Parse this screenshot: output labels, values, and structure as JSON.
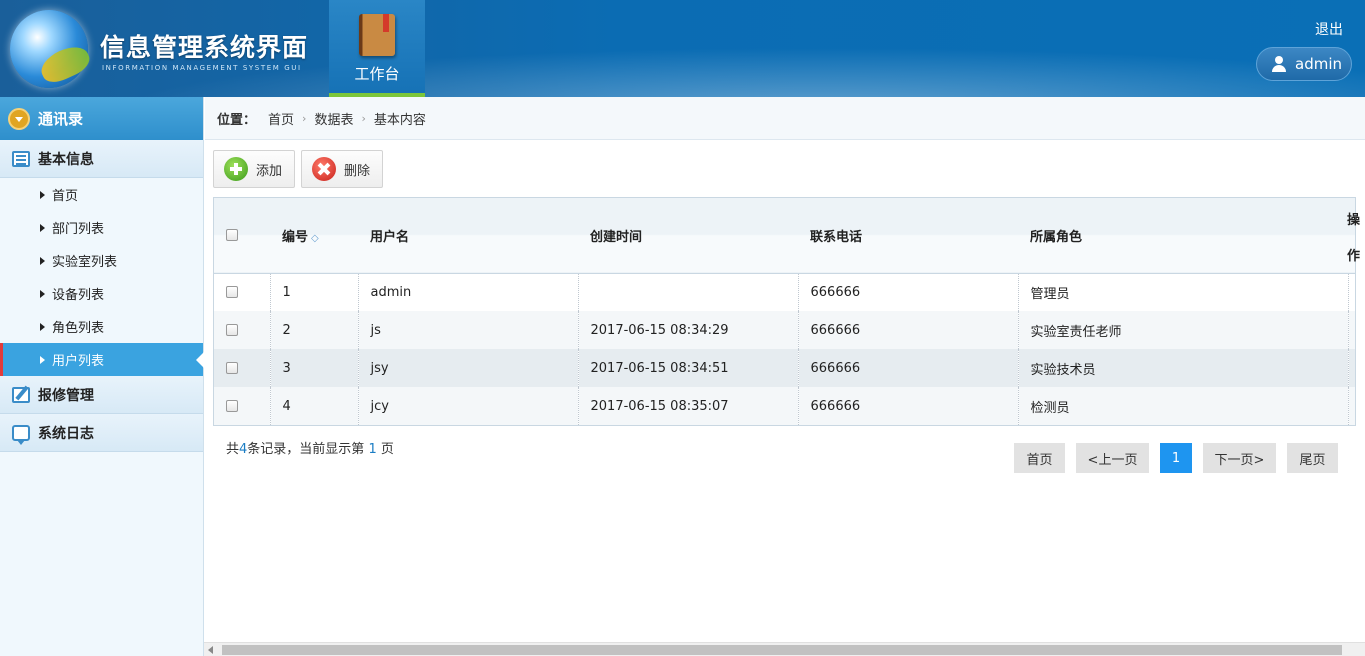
{
  "header": {
    "title": "信息管理系统界面",
    "subtitle": "INFORMATION MANAGEMENT SYSTEM GUI",
    "nav_tab": "工作台",
    "logout": "退出",
    "user": "admin"
  },
  "sidebar": {
    "top_group": "通讯录",
    "group1": "基本信息",
    "items": [
      {
        "label": "首页"
      },
      {
        "label": "部门列表"
      },
      {
        "label": "实验室列表"
      },
      {
        "label": "设备列表"
      },
      {
        "label": "角色列表"
      },
      {
        "label": "用户列表"
      }
    ],
    "group2": "报修管理",
    "group3": "系统日志"
  },
  "breadcrumb": {
    "lead": "位置：",
    "items": [
      "首页",
      "数据表",
      "基本内容"
    ]
  },
  "toolbar": {
    "add_label": "添加",
    "delete_label": "删除"
  },
  "table": {
    "columns": [
      "编号",
      "用户名",
      "创建时间",
      "联系电话",
      "所属角色"
    ],
    "op_column": "操作",
    "rows": [
      {
        "id": "1",
        "username": "admin",
        "created": "",
        "phone": "666666",
        "role": "管理员"
      },
      {
        "id": "2",
        "username": "js",
        "created": "2017-06-15 08:34:29",
        "phone": "666666",
        "role": "实验室责任老师"
      },
      {
        "id": "3",
        "username": "jsy",
        "created": "2017-06-15 08:34:51",
        "phone": "666666",
        "role": "实验技术员"
      },
      {
        "id": "4",
        "username": "jcy",
        "created": "2017-06-15 08:35:07",
        "phone": "666666",
        "role": "检测员"
      }
    ]
  },
  "pager": {
    "info_prefix": "共",
    "total": "4",
    "info_mid": "条记录，当前显示第",
    "current_page": "1",
    "info_suffix": "页",
    "first": "首页",
    "prev": "<上一页",
    "page1": "1",
    "next": "下一页>",
    "last": "尾页"
  },
  "colors": {
    "header_blue": "#0b6cb3",
    "active_item": "#3aa3e0",
    "pager_current": "#1e95f0"
  }
}
